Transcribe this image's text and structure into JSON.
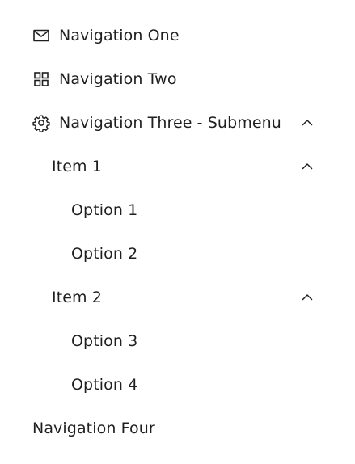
{
  "menu": {
    "items": [
      {
        "label": "Navigation One",
        "icon": "mail-icon"
      },
      {
        "label": "Navigation Two",
        "icon": "appstore-icon"
      },
      {
        "label": "Navigation Three - Submenu",
        "icon": "setting-icon",
        "expanded": true,
        "children": [
          {
            "label": "Item 1",
            "expanded": true,
            "children": [
              {
                "label": "Option 1"
              },
              {
                "label": "Option 2"
              }
            ]
          },
          {
            "label": "Item 2",
            "expanded": true,
            "children": [
              {
                "label": "Option 3"
              },
              {
                "label": "Option 4"
              }
            ]
          }
        ]
      },
      {
        "label": "Navigation Four"
      }
    ]
  },
  "colors": {
    "text": "#1f1f1f",
    "background": "#ffffff"
  }
}
